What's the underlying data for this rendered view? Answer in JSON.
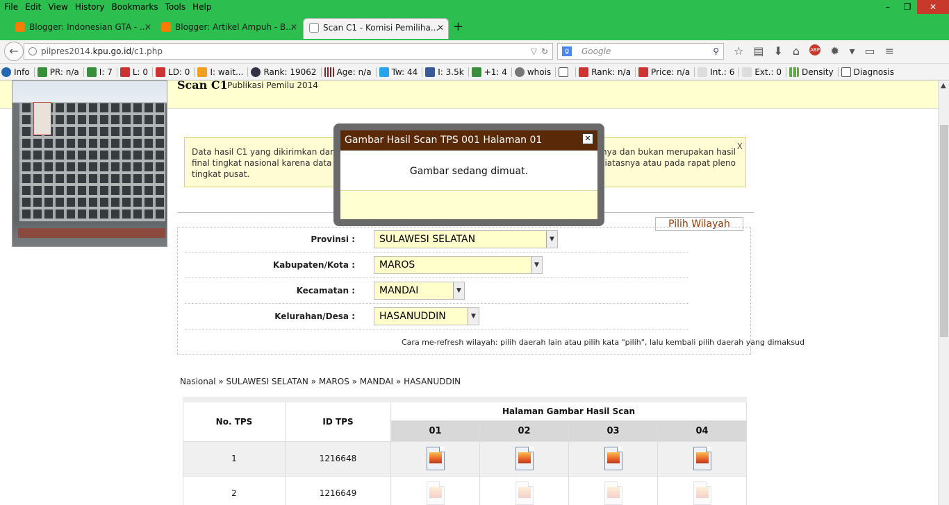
{
  "menu": [
    "File",
    "Edit",
    "View",
    "History",
    "Bookmarks",
    "Tools",
    "Help"
  ],
  "window_controls": {
    "minimize": "–",
    "restore": "❐",
    "close": "✕"
  },
  "tabs": [
    {
      "label": "Blogger: Indonesian GTA - ...",
      "close": "✕"
    },
    {
      "label": "Blogger: Artikel Ampuh - B...",
      "close": "✕"
    },
    {
      "label": "Scan C1 - Komisi Pemiliha...",
      "close": "✕"
    }
  ],
  "new_tab": "+",
  "url": {
    "prefix": "pilpres2014.",
    "host": "kpu.go.id",
    "path": "/c1.php"
  },
  "search": {
    "placeholder": "Google"
  },
  "addons": [
    {
      "label": "Info",
      "icon": "info-icon"
    },
    {
      "label": "PR: n/a",
      "icon": "google-icon"
    },
    {
      "label": "I: 7",
      "icon": "google-icon"
    },
    {
      "label": "L: 0",
      "icon": "yahoo-icon"
    },
    {
      "label": "LD: 0",
      "icon": "yahoo-icon"
    },
    {
      "label": "I: wait...",
      "icon": "bing-icon"
    },
    {
      "label": "Rank: 19062",
      "icon": "alexa-icon"
    },
    {
      "label": "Age: n/a",
      "icon": "archive-icon"
    },
    {
      "label": "Tw: 44",
      "icon": "twitter-icon"
    },
    {
      "label": "I: 3.5k",
      "icon": "facebook-icon"
    },
    {
      "label": "+1: 4",
      "icon": "google-plus-icon"
    },
    {
      "label": "whois",
      "icon": "gear-icon"
    },
    {
      "label": "",
      "icon": "source-icon"
    },
    {
      "label": "Rank: n/a",
      "icon": "semrush-icon"
    },
    {
      "label": "Price: n/a",
      "icon": "semrush-icon"
    },
    {
      "label": "Int.: 6",
      "icon": "internal-links-icon"
    },
    {
      "label": "Ext.: 0",
      "icon": "external-links-icon"
    },
    {
      "label": "Density",
      "icon": "density-icon"
    },
    {
      "label": "Diagnosis",
      "icon": "diagnosis-icon"
    }
  ],
  "page": {
    "title": "Scan C1",
    "subtitle": "Publikasi Pemilu 2014",
    "notice": {
      "line1_left": "Data hasil C1 yang dikirimkan dari Ka",
      "line1_right": "tannya dan bukan merupakan hasil",
      "line2_left": "final tingkat nasional karena data ters",
      "line2_right": "diatasnya atau pada rapat pleno",
      "line3": "tingkat pusat.",
      "close": "X"
    },
    "pilih_wilayah": "Pilih Wilayah",
    "form": {
      "provinsi": {
        "label": "Provinsi :",
        "value": "SULAWESI SELATAN"
      },
      "kabupaten": {
        "label": "Kabupaten/Kota :",
        "value": "MAROS"
      },
      "kecamatan": {
        "label": "Kecamatan :",
        "value": "MANDAI"
      },
      "kelurahan": {
        "label": "Kelurahan/Desa :",
        "value": "HASANUDDIN"
      }
    },
    "refresh_note": "Cara me-refresh wilayah: pilih daerah lain atau pilih kata \"pilih\", lalu kembali pilih daerah yang dimaksud",
    "breadcrumb": "Nasional » SULAWESI SELATAN » MAROS » MANDAI » HASANUDDIN",
    "table": {
      "col_no": "No. TPS",
      "col_id": "ID TPS",
      "col_pages": "Halaman Gambar Hasil Scan",
      "pages": [
        "01",
        "02",
        "03",
        "04"
      ],
      "rows": [
        {
          "no": "1",
          "id": "1216648"
        },
        {
          "no": "2",
          "id": "1216649"
        }
      ]
    }
  },
  "dialog": {
    "title": "Gambar Hasil Scan TPS 001 Halaman 01",
    "close": "✕",
    "message": "Gambar sedang dimuat."
  }
}
